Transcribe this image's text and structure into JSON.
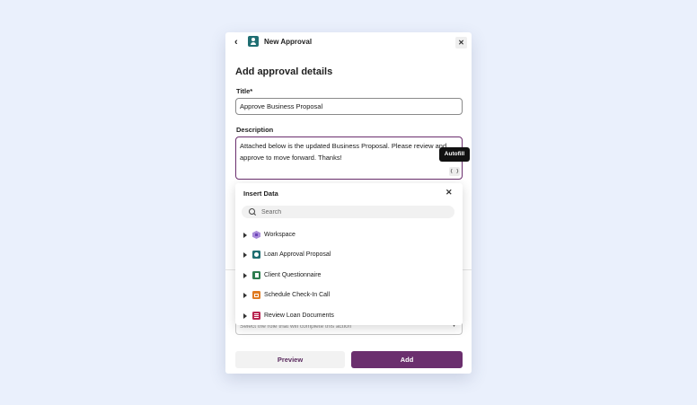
{
  "header": {
    "title": "New Approval"
  },
  "form": {
    "section_title": "Add approval details",
    "title_label": "Title*",
    "title_value": "Approve Business Proposal",
    "description_label": "Description",
    "description_value": "Attached below is the updated Business Proposal. Please review and approve to move forward. Thanks!",
    "autofill_tooltip": "Autofill",
    "insert_data_glyph": "{ }",
    "role_placeholder": "Select the role that will complete this action"
  },
  "insert_data": {
    "title": "Insert Data",
    "search_placeholder": "Search",
    "items": [
      {
        "label": "Workspace",
        "icon": "workspace-icon",
        "color": "#a98bd9"
      },
      {
        "label": "Loan Approval Proposal",
        "icon": "approval-icon",
        "color": "#1f6e72"
      },
      {
        "label": "Client Questionnaire",
        "icon": "form-icon",
        "color": "#2e7d4f"
      },
      {
        "label": "Schedule Check-In Call",
        "icon": "calendar-icon",
        "color": "#e07b22"
      },
      {
        "label": "Review Loan Documents",
        "icon": "checklist-icon",
        "color": "#b8234f"
      }
    ]
  },
  "footer": {
    "preview_label": "Preview",
    "add_label": "Add"
  },
  "colors": {
    "accent": "#6b2f6e",
    "background": "#eaf0fc"
  }
}
